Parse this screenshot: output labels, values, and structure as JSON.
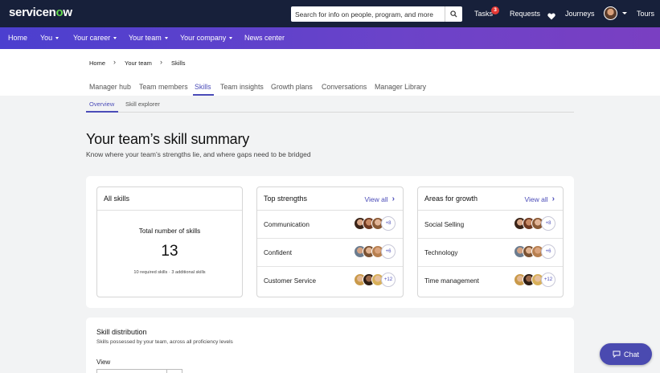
{
  "topbar": {
    "logo_pre": "servicen",
    "logo_o": "o",
    "logo_post": "w",
    "search_placeholder": "Search for info on people, program, and more",
    "tasks": "Tasks",
    "tasks_count": "3",
    "requests": "Requests",
    "journeys": "Journeys",
    "tours": "Tours"
  },
  "mainnav": {
    "items": [
      {
        "label": "Home"
      },
      {
        "label": "You"
      },
      {
        "label": "Your career"
      },
      {
        "label": "Your team"
      },
      {
        "label": "Your company"
      },
      {
        "label": "News center"
      }
    ]
  },
  "breadcrumb": [
    "Home",
    "Your team",
    "Skills"
  ],
  "tabs": [
    "Manager hub",
    "Team members",
    "Skills",
    "Team insights",
    "Growth plans",
    "Conversations",
    "Manager Library"
  ],
  "subtabs": [
    "Overview",
    "Skill explorer"
  ],
  "page": {
    "title": "Your team’s skill summary",
    "subtitle": "Know where your team’s strengths lie, and where gaps need to be bridged"
  },
  "all_skills": {
    "header": "All skills",
    "total_label": "Total number of skills",
    "total_value": "13",
    "note": "10 required skills · 3 additional skills"
  },
  "top_strengths": {
    "header": "Top strengths",
    "view_all": "View all",
    "rows": [
      {
        "label": "Communication",
        "more": "+8"
      },
      {
        "label": "Confident",
        "more": "+6"
      },
      {
        "label": "Customer Service",
        "more": "+12"
      }
    ]
  },
  "areas_for_growth": {
    "header": "Areas for growth",
    "view_all": "View all",
    "rows": [
      {
        "label": "Social Selling",
        "more": "+8"
      },
      {
        "label": "Technology",
        "more": "+6"
      },
      {
        "label": "Time management",
        "more": "+12"
      }
    ]
  },
  "distribution": {
    "title": "Skill distribution",
    "subtitle": "Skills possessed by your team, across all proficiency levels",
    "view_label": "View"
  },
  "chat": {
    "label": "Chat"
  },
  "colors": {
    "accent": "#4b4cb8",
    "topbar": "#17203a",
    "nav_start": "#4b3fcf",
    "nav_end": "#7a3fc2"
  }
}
